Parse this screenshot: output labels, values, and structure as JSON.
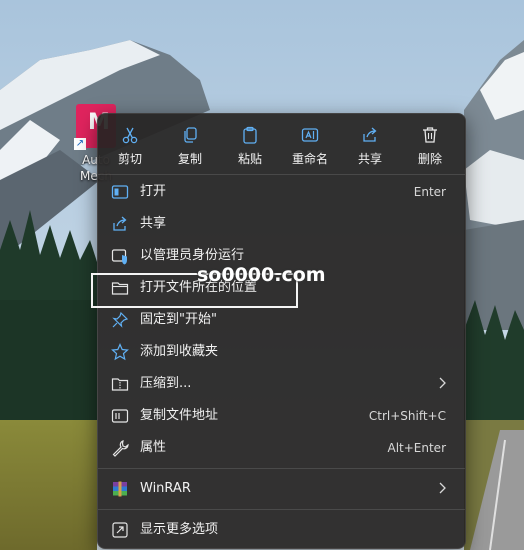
{
  "desktop": {
    "shortcut_label_line1": "Auto",
    "shortcut_label_line2": "Mech",
    "icon_letter": "M"
  },
  "toolbar": [
    {
      "label": "剪切",
      "icon": "scissors-icon"
    },
    {
      "label": "复制",
      "icon": "copy-icon"
    },
    {
      "label": "粘贴",
      "icon": "paste-icon"
    },
    {
      "label": "重命名",
      "icon": "rename-icon"
    },
    {
      "label": "共享",
      "icon": "share-icon"
    },
    {
      "label": "删除",
      "icon": "delete-icon"
    }
  ],
  "items": [
    {
      "label": "打开",
      "shortcut": "Enter",
      "icon": "open-app-icon"
    },
    {
      "label": "共享",
      "shortcut": "",
      "icon": "share-icon"
    },
    {
      "label": "以管理员身份运行",
      "shortcut": "",
      "icon": "admin-shield-icon"
    },
    {
      "label": "打开文件所在的位置",
      "shortcut": "",
      "icon": "folder-icon"
    },
    {
      "label": "固定到\"开始\"",
      "shortcut": "",
      "icon": "pin-icon"
    },
    {
      "label": "添加到收藏夹",
      "shortcut": "",
      "icon": "star-icon"
    },
    {
      "label": "压缩到...",
      "shortcut": "",
      "icon": "zip-folder-icon",
      "submenu": true
    },
    {
      "label": "复制文件地址",
      "shortcut": "Ctrl+Shift+C",
      "icon": "copy-path-icon"
    },
    {
      "label": "属性",
      "shortcut": "Alt+Enter",
      "icon": "wrench-icon"
    },
    {
      "label": "WinRAR",
      "shortcut": "",
      "icon": "winrar-icon",
      "submenu": true
    },
    {
      "label": "显示更多选项",
      "shortcut": "",
      "icon": "more-options-icon"
    }
  ],
  "watermark": "so0000.com",
  "colors": {
    "menu_bg": "#262422",
    "text": "#f2f2f2",
    "accent_blue": "#60b0f4"
  }
}
